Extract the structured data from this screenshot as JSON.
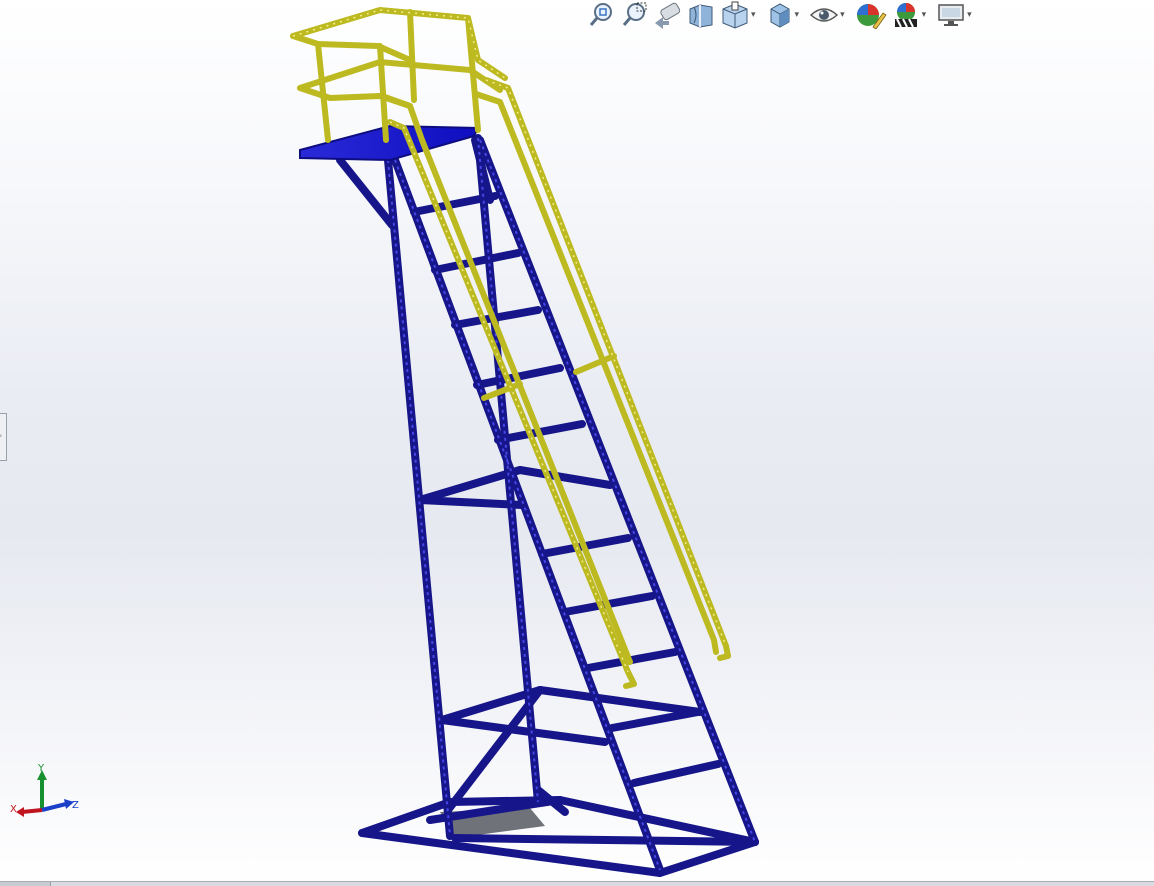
{
  "toolbar": {
    "items": [
      {
        "name": "zoom-to-fit-icon",
        "dropdown": false
      },
      {
        "name": "zoom-to-area-icon",
        "dropdown": false
      },
      {
        "name": "previous-view-icon",
        "dropdown": false
      },
      {
        "name": "section-view-icon",
        "dropdown": false
      },
      {
        "name": "view-orientation-icon",
        "dropdown": true
      },
      {
        "name": "display-style-icon",
        "dropdown": true
      },
      {
        "name": "hide-show-items-icon",
        "dropdown": true
      },
      {
        "name": "edit-appearance-icon",
        "dropdown": false
      },
      {
        "name": "apply-scene-icon",
        "dropdown": true
      },
      {
        "name": "view-settings-icon",
        "dropdown": true
      }
    ],
    "dropdown_glyph": "▾"
  },
  "triad": {
    "x_label": "X",
    "y_label": "Y",
    "z_label": "Z",
    "colors": {
      "x": "#c0141e",
      "y": "#17912f",
      "z": "#1a3fc9"
    }
  },
  "model": {
    "frame_color": "#16168a",
    "frame_highlight": "#3a3ad0",
    "handrail_color": "#c8c42a",
    "platform_color": "#1a1ae0"
  },
  "left_panel_tab": {
    "glyph": "›"
  }
}
